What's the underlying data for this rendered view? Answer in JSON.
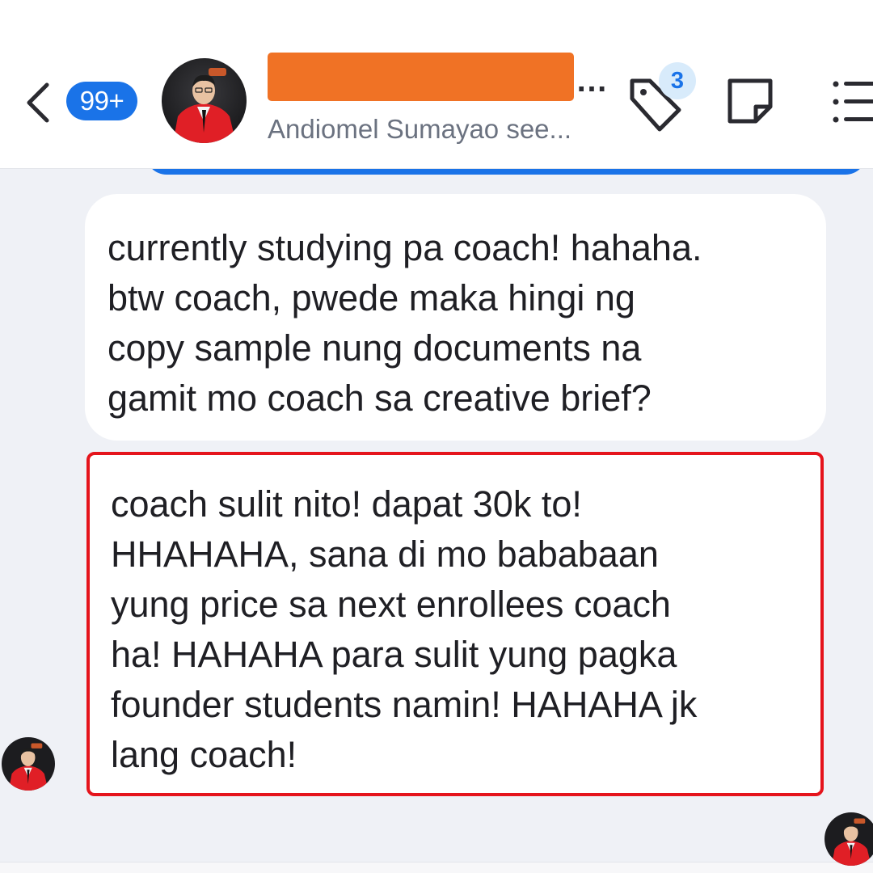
{
  "header": {
    "back_icon": "chevron-left-icon",
    "unread_count": "99+",
    "contact_name": "",
    "name_overflow": "…",
    "seen_status": "Andiomel Sumayao see...",
    "tag_icon": "tag-icon",
    "tag_count": "3",
    "note_icon": "sticky-note-icon",
    "menu_icon": "list-menu-icon"
  },
  "messages": [
    {
      "lines": [
        "currently studying pa coach! hahaha.",
        "btw coach, pwede maka hingi ng",
        "copy sample nung documents na",
        "gamit mo coach sa creative brief?"
      ]
    },
    {
      "lines": [
        "coach sulit nito! dapat 30k to!",
        "HHAHAHA, sana di mo bababaan",
        "yung price sa next enrollees coach",
        "ha! HAHAHA para sulit yung pagka",
        "founder students namin! HAHAHA jk",
        "lang coach!"
      ],
      "highlighted": true
    }
  ],
  "colors": {
    "accent": "#1a73e8",
    "redaction": "#f07225",
    "highlight_border": "#e5141c",
    "background": "#eff1f6",
    "bubble": "#ffffff"
  }
}
